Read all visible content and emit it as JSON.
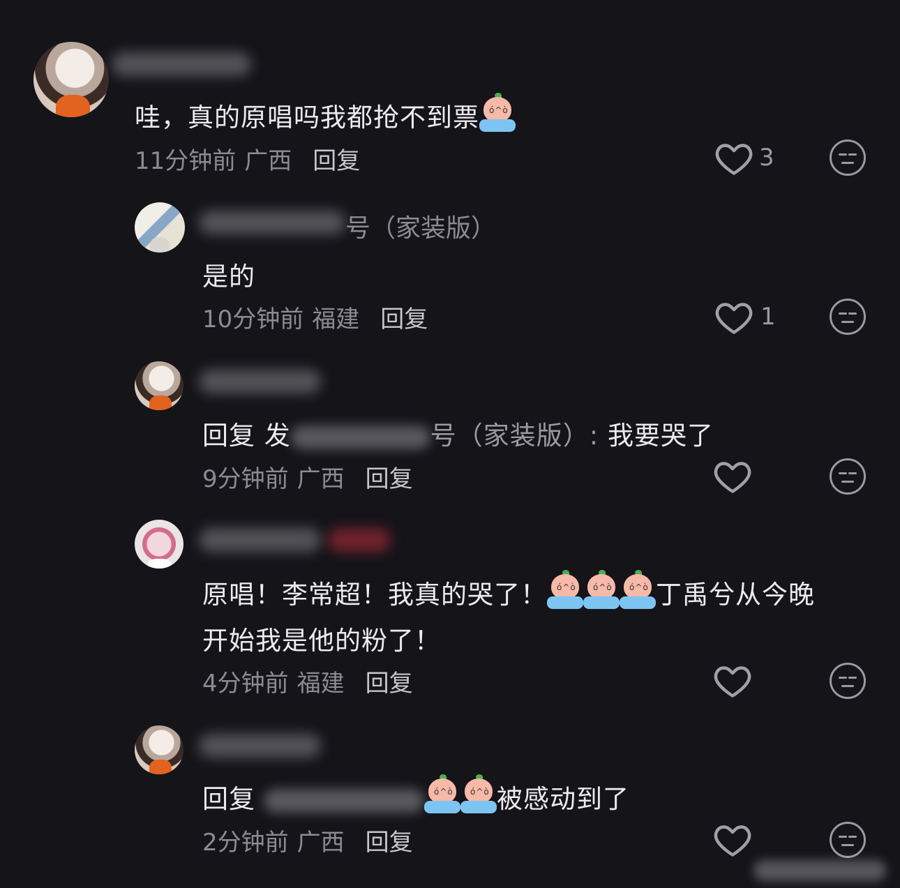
{
  "comments": [
    {
      "id": "c1",
      "text": "哇，真的原唱吗我都抢不到票",
      "time": "11分钟前",
      "location": "广西",
      "reply_label": "回复",
      "likes": "3"
    },
    {
      "id": "c2",
      "name_tail": "号（家装版）",
      "text": "是的",
      "time": "10分钟前",
      "location": "福建",
      "reply_label": "回复",
      "likes": "1"
    },
    {
      "id": "c3",
      "text_prefix": "回复 发",
      "text_mid": "号（家装版）: ",
      "text_end": "我要哭了",
      "time": "9分钟前",
      "location": "广西",
      "reply_label": "回复",
      "likes": ""
    },
    {
      "id": "c4",
      "text_line1_a": "原唱！李常超！我真的哭了！",
      "text_line1_b": "丁禹兮从今晚",
      "text_line2": "开始我是他的粉了！",
      "time": "4分钟前",
      "location": "福建",
      "reply_label": "回复",
      "likes": ""
    },
    {
      "id": "c5",
      "text_prefix": "回复",
      "text_end": "被感动到了",
      "time": "2分钟前",
      "location": "广西",
      "reply_label": "回复",
      "likes": ""
    }
  ],
  "icons": {
    "like": "heart-outline-icon",
    "dislike": "neutral-face-icon",
    "emoji": "crying-peach-emoji"
  },
  "colors": {
    "background": "#141419",
    "text": "#ececef",
    "meta": "#8b8b92"
  }
}
